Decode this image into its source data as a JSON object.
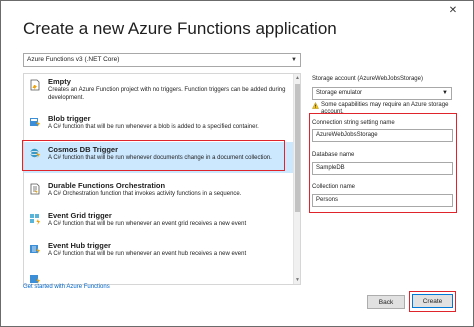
{
  "window": {
    "title": "Create a new Azure Functions application",
    "close_glyph": "✕"
  },
  "version_select": {
    "value": "Azure Functions v3 (.NET Core)"
  },
  "templates": [
    {
      "name": "Empty",
      "description": "Creates an Azure Function project with no triggers. Function triggers can be added during development.",
      "icon": "empty-icon"
    },
    {
      "name": "Blob trigger",
      "description": "A C# function that will be run whenever a blob is added to a specified container.",
      "icon": "blob-trigger-icon"
    },
    {
      "name": "Cosmos DB Trigger",
      "description": "A C# function that will be run whenever documents change in a document collection.",
      "icon": "cosmos-db-icon"
    },
    {
      "name": "Durable Functions Orchestration",
      "description": "A C# Orchestration function that invokes activity functions in a sequence.",
      "icon": "durable-functions-icon"
    },
    {
      "name": "Event Grid trigger",
      "description": "A C# function that will be run whenever an event grid receives a new event",
      "icon": "event-grid-icon"
    },
    {
      "name": "Event Hub trigger",
      "description": "A C# function that will be run whenever an event hub receives a new event",
      "icon": "event-hub-icon"
    },
    {
      "name": "",
      "description": "",
      "icon": "generic-trigger-icon"
    }
  ],
  "selected_template": "Cosmos DB Trigger",
  "get_started_link": "Get started with Azure Functions",
  "settings": {
    "storage_label": "Storage account (AzureWebJobsStorage)",
    "storage_value": "Storage emulator",
    "warning_text": "Some capabilities may require an Azure storage account.",
    "connection_label": "Connection string setting name",
    "connection_value": "AzureWebJobsStorage",
    "database_label": "Database name",
    "database_value": "SampleDB",
    "collection_label": "Collection name",
    "collection_value": "Persons"
  },
  "buttons": {
    "back": "Back",
    "create": "Create"
  },
  "colors": {
    "highlight": "#e0242c",
    "selection": "#cce8ff",
    "link": "#0066cc",
    "focus": "#0078d7"
  }
}
